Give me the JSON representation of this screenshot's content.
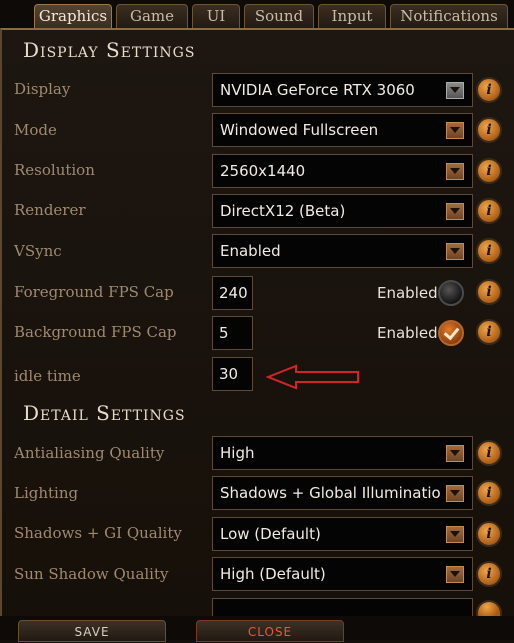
{
  "tabs": [
    {
      "label": "Graphics",
      "active": true
    },
    {
      "label": "Game"
    },
    {
      "label": "UI"
    },
    {
      "label": "Sound"
    },
    {
      "label": "Input"
    },
    {
      "label": "Notifications"
    }
  ],
  "display_settings": {
    "title": "Display Settings",
    "rows": {
      "display": {
        "label": "Display",
        "value": "NVIDIA GeForce RTX 3060"
      },
      "mode": {
        "label": "Mode",
        "value": "Windowed Fullscreen"
      },
      "resolution": {
        "label": "Resolution",
        "value": "2560x1440"
      },
      "renderer": {
        "label": "Renderer",
        "value": "DirectX12 (Beta)"
      },
      "vsync": {
        "label": "VSync",
        "value": "Enabled"
      },
      "foreground_fps": {
        "label": "Foreground FPS Cap",
        "value": "240",
        "toggle_label": "Enabled",
        "toggle_on": false
      },
      "background_fps": {
        "label": "Background FPS Cap",
        "value": "5",
        "toggle_label": "Enabled",
        "toggle_on": true
      },
      "idle_time": {
        "label": "idle time",
        "value": "30"
      }
    }
  },
  "detail_settings": {
    "title": "Detail Settings",
    "rows": {
      "antialiasing": {
        "label": "Antialiasing Quality",
        "value": "High"
      },
      "lighting": {
        "label": "Lighting",
        "value": "Shadows + Global Illuminatio"
      },
      "shadows_gi": {
        "label": "Shadows + GI Quality",
        "value": "Low (Default)"
      },
      "sun_shadow": {
        "label": "Sun Shadow Quality",
        "value": "High (Default)"
      }
    }
  },
  "info_icon": "info-icon",
  "annotation": {
    "color": "#d4242a",
    "icon": "red-arrow-annotation"
  },
  "footer": {
    "save_label": "SAVE",
    "close_label": "CLOSE"
  }
}
